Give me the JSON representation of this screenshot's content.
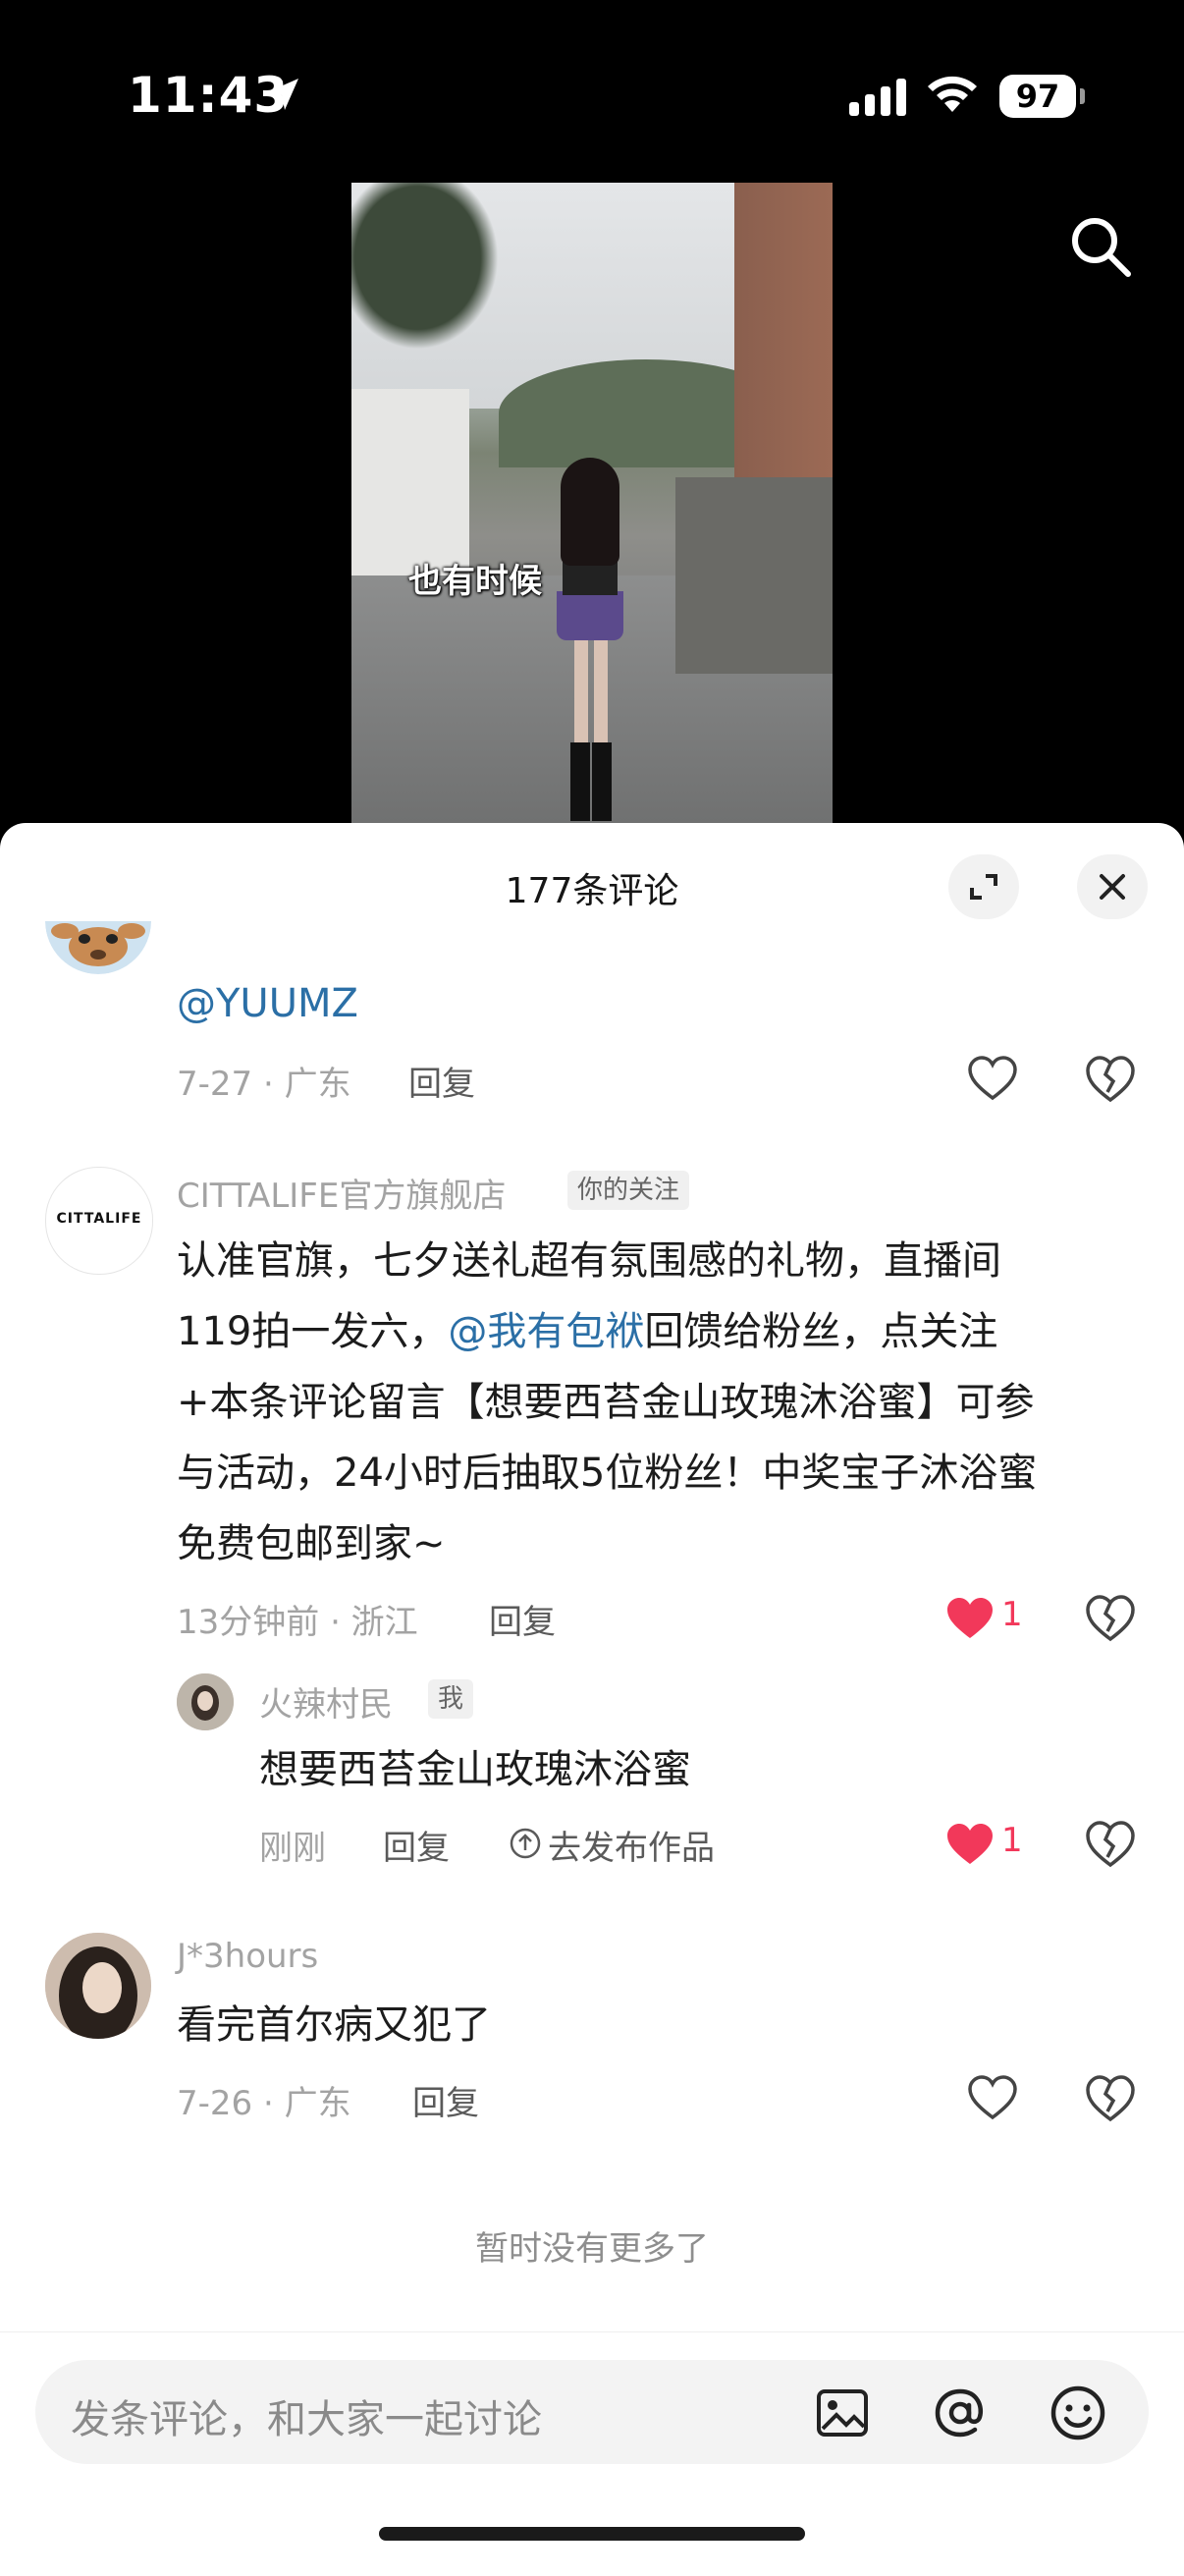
{
  "status_bar": {
    "time": "11:43",
    "battery": "97"
  },
  "video": {
    "caption": "也有时候"
  },
  "sheet": {
    "title": "177条评论",
    "comments": [
      {
        "user": "",
        "text": "@YUUMZ",
        "date_region": "7-27 · 广东",
        "reply_label": "回复"
      },
      {
        "user": "CITTALIFE官方旗舰店",
        "tag": "你的关注",
        "avatar_text": "CITTALIFE",
        "text_line1": "认准官旗，七夕送礼超有氛围感的礼物，直播间",
        "text_line2_a": "119拍一发六，",
        "text_line2_mention": "@我有包袱",
        "text_line2_b": "回馈给粉丝，点关注",
        "text_line3": "+本条评论留言【想要西苔金山玫瑰沐浴蜜】可参",
        "text_line4": "与活动，24小时后抽取5位粉丝！中奖宝子沐浴蜜",
        "text_line5": "免费包邮到家~",
        "date_region": "13分钟前 · 浙江",
        "reply_label": "回复",
        "likes": "1",
        "reply": {
          "user": "火辣村民",
          "tag": "我",
          "text": "想要西苔金山玫瑰沐浴蜜",
          "date": "刚刚",
          "reply_label": "回复",
          "publish_label": "去发布作品",
          "likes": "1"
        }
      },
      {
        "user": "J*3hours",
        "text": "看完首尔病又犯了",
        "date_region": "7-26 · 广东",
        "reply_label": "回复"
      }
    ],
    "no_more": "暂时没有更多了"
  },
  "input": {
    "placeholder": "发条评论，和大家一起讨论"
  },
  "icons": [
    "location-arrow-icon",
    "signal-icon",
    "wifi-icon",
    "search-icon",
    "expand-icon",
    "close-icon",
    "heart-icon",
    "dislike-heart-icon",
    "image-icon",
    "at-icon",
    "emoji-icon"
  ],
  "colors": {
    "like_red": "#f2385a",
    "mention_blue": "#2b6fa6"
  }
}
